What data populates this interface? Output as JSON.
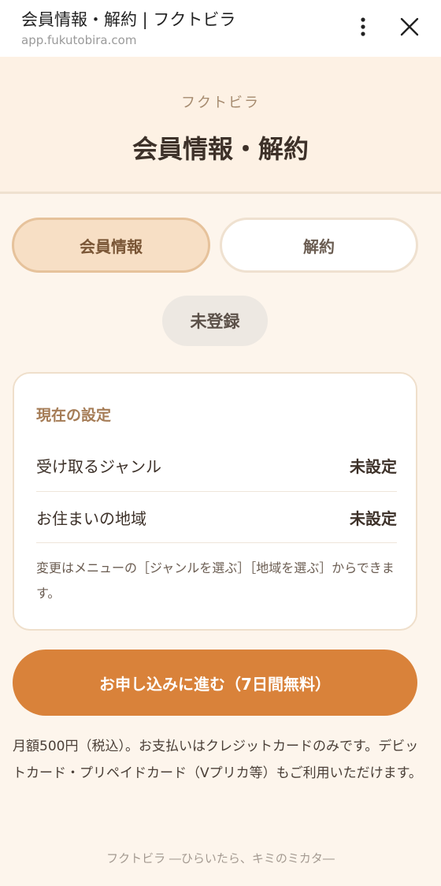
{
  "browser": {
    "title": "会員情報・解約 | フクトビラ",
    "url": "app.fukutobira.com",
    "menu_icon": "more-vertical-icon",
    "close_icon": "close-icon"
  },
  "header": {
    "brand": "フクトビラ",
    "title": "会員情報・解約"
  },
  "tabs": [
    {
      "label": "会員情報",
      "active": true
    },
    {
      "label": "解約",
      "active": false
    }
  ],
  "status": {
    "label": "未登録"
  },
  "settings": {
    "title": "現在の設定",
    "rows": [
      {
        "label": "受け取るジャンル",
        "value": "未設定"
      },
      {
        "label": "お住まいの地域",
        "value": "未設定"
      }
    ],
    "note": "変更はメニューの［ジャンルを選ぶ］［地域を選ぶ］からできます。"
  },
  "cta": {
    "label": "お申し込みに進む（7日間無料）"
  },
  "price_note": "月額500円（税込）。お支払いはクレジットカードのみです。デビットカード・プリペイドカード（Vプリカ等）もご利用いただけます。",
  "footer": "フクトビラ ―ひらいたら、キミのミカタ―",
  "colors": {
    "accent": "#d9823a",
    "header_bg": "#fdf1e4",
    "page_bg": "#fdf5ec",
    "active_tab_bg": "#f7dfc5"
  }
}
